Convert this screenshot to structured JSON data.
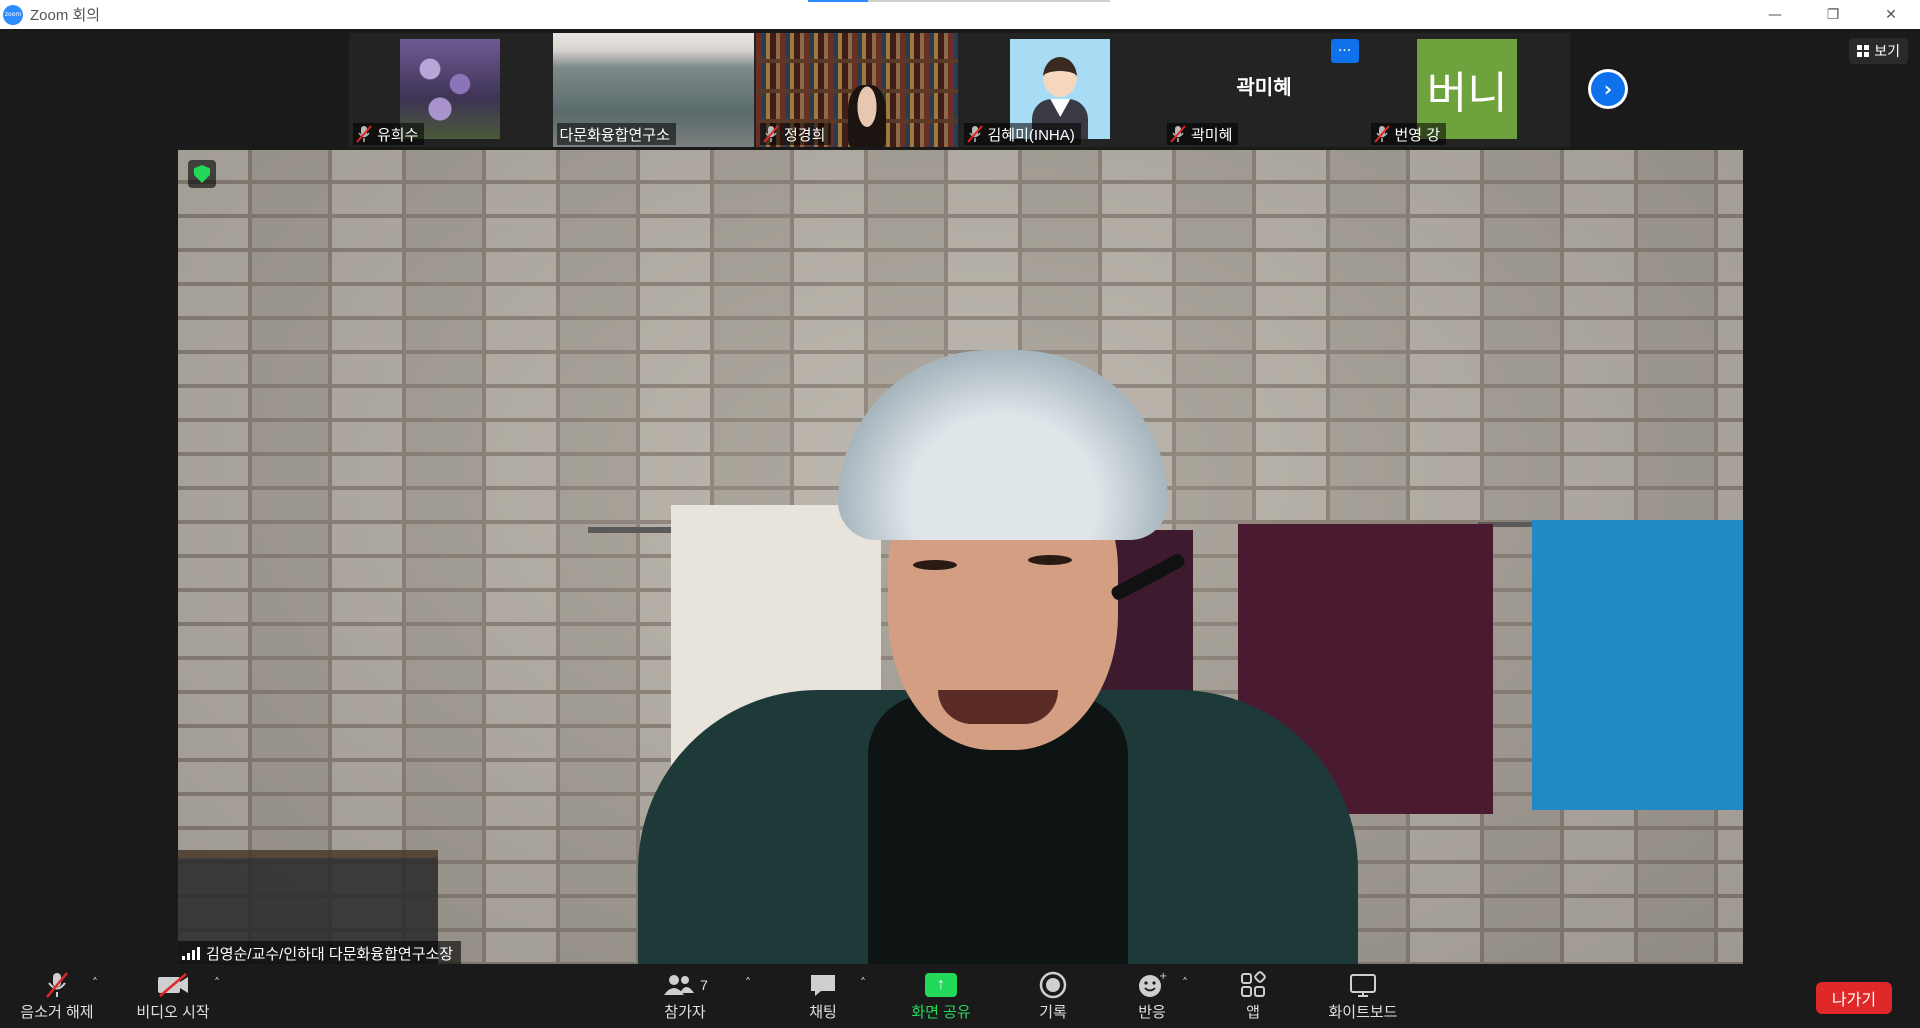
{
  "window": {
    "title": "Zoom 회의",
    "logo_text": "zoom",
    "minimize_icon": "minimize-icon",
    "restore_icon": "restore-icon",
    "close_icon": "close-icon"
  },
  "view_button": {
    "label": "보기",
    "icon": "grid-icon"
  },
  "participants": [
    {
      "name": "유희수",
      "muted": true,
      "thumb": "wisteria-photo"
    },
    {
      "name": "다문화융합연구소",
      "muted": false,
      "thumb": "room-video"
    },
    {
      "name": "정경희",
      "muted": true,
      "thumb": "bookshelf-video"
    },
    {
      "name": "김혜미(INHA)",
      "muted": true,
      "thumb": "cartoon-avatar"
    },
    {
      "name": "곽미혜",
      "muted": true,
      "thumb": "name-only",
      "center_name": "곽미혜",
      "more_label": "···"
    },
    {
      "name": "번영 강",
      "muted": true,
      "thumb": "initials",
      "initials": "버니",
      "initials_color": "#6ea23c"
    }
  ],
  "next_page_icon": "chevron-right-icon",
  "speaker": {
    "name": "김영순/교수/인하대 다문화융합연구소장",
    "security_icon": "shield-check-icon",
    "signal_icon": "signal-bars-icon"
  },
  "toolbar": {
    "unmute_label": "음소거 해제",
    "start_video_label": "비디오 시작",
    "participants_label": "참가자",
    "participants_count": "7",
    "chat_label": "채팅",
    "share_label": "화면 공유",
    "record_label": "기록",
    "reactions_label": "반응",
    "apps_label": "앱",
    "whiteboard_label": "화이트보드",
    "leave_label": "나가기"
  },
  "colors": {
    "accent_blue": "#0e72ed",
    "share_green": "#23d959",
    "leave_red": "#e02828",
    "mute_red": "#e02828"
  }
}
